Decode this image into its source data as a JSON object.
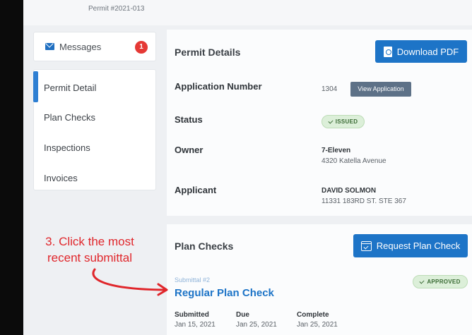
{
  "header": {
    "permit_number": "Permit #2021-013"
  },
  "sidebar": {
    "messages": {
      "label": "Messages",
      "count": "1"
    },
    "items": [
      {
        "label": "Permit Detail"
      },
      {
        "label": "Plan Checks"
      },
      {
        "label": "Inspections"
      },
      {
        "label": "Invoices"
      }
    ]
  },
  "permit_details": {
    "title": "Permit Details",
    "download_label": "Download PDF",
    "application_number": {
      "label": "Application Number",
      "value": "1304",
      "action": "View Application"
    },
    "status": {
      "label": "Status",
      "value": "ISSUED"
    },
    "owner": {
      "label": "Owner",
      "name": "7-Eleven",
      "address": "4320 Katella Avenue"
    },
    "applicant": {
      "label": "Applicant",
      "name": "DAVID SOLMON",
      "address": "11331 183RD ST. STE 367"
    }
  },
  "plan_checks": {
    "title": "Plan Checks",
    "request_label": "Request Plan Check",
    "submittal": {
      "label": "Submittal #2",
      "name": "Regular Plan Check",
      "status": "APPROVED",
      "submitted": {
        "label": "Submitted",
        "value": "Jan 15, 2021"
      },
      "due": {
        "label": "Due",
        "value": "Jan 25, 2021"
      },
      "complete": {
        "label": "Complete",
        "value": "Jan 25, 2021"
      }
    }
  },
  "annotation": {
    "line1": "3. Click the most",
    "line2": "recent submittal"
  },
  "colors": {
    "accent": "#1d74c7",
    "badge_red": "#e53935",
    "annotation": "#e0262b",
    "status_green": "#dcefd9"
  }
}
